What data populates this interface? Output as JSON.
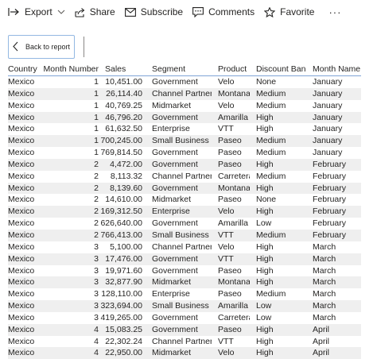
{
  "toolbar": {
    "export_label": "Export",
    "share_label": "Share",
    "subscribe_label": "Subscribe",
    "comments_label": "Comments",
    "favorite_label": "Favorite",
    "more_label": "···"
  },
  "back_button": {
    "label": "Back to report"
  },
  "table": {
    "headers": {
      "country": "Country",
      "month_number": "Month Number",
      "sales": "Sales",
      "segment": "Segment",
      "product": "Product",
      "discount_band": "Discount Band",
      "month_name": "Month Name"
    },
    "rows": [
      [
        "Mexico",
        "1",
        "10,451.00",
        "Government",
        "Velo",
        "None",
        "January"
      ],
      [
        "Mexico",
        "1",
        "26,114.40",
        "Channel Partners",
        "Montana",
        "Medium",
        "January"
      ],
      [
        "Mexico",
        "1",
        "40,769.25",
        "Midmarket",
        "Velo",
        "Medium",
        "January"
      ],
      [
        "Mexico",
        "1",
        "46,796.20",
        "Government",
        "Amarilla",
        "High",
        "January"
      ],
      [
        "Mexico",
        "1",
        "61,632.50",
        "Enterprise",
        "VTT",
        "High",
        "January"
      ],
      [
        "Mexico",
        "1",
        "700,245.00",
        "Small Business",
        "Paseo",
        "Medium",
        "January"
      ],
      [
        "Mexico",
        "1",
        "769,814.50",
        "Government",
        "Paseo",
        "Medium",
        "January"
      ],
      [
        "Mexico",
        "2",
        "4,472.00",
        "Government",
        "Paseo",
        "High",
        "February"
      ],
      [
        "Mexico",
        "2",
        "8,113.32",
        "Channel Partners",
        "Carretera",
        "Medium",
        "February"
      ],
      [
        "Mexico",
        "2",
        "8,139.60",
        "Government",
        "Montana",
        "High",
        "February"
      ],
      [
        "Mexico",
        "2",
        "14,610.00",
        "Midmarket",
        "Paseo",
        "None",
        "February"
      ],
      [
        "Mexico",
        "2",
        "169,312.50",
        "Enterprise",
        "Velo",
        "High",
        "February"
      ],
      [
        "Mexico",
        "2",
        "626,640.00",
        "Government",
        "Amarilla",
        "Low",
        "February"
      ],
      [
        "Mexico",
        "2",
        "766,413.00",
        "Small Business",
        "VTT",
        "Medium",
        "February"
      ],
      [
        "Mexico",
        "3",
        "5,100.00",
        "Channel Partners",
        "Velo",
        "High",
        "March"
      ],
      [
        "Mexico",
        "3",
        "17,476.00",
        "Government",
        "VTT",
        "High",
        "March"
      ],
      [
        "Mexico",
        "3",
        "19,971.60",
        "Government",
        "Paseo",
        "High",
        "March"
      ],
      [
        "Mexico",
        "3",
        "32,877.90",
        "Midmarket",
        "Montana",
        "High",
        "March"
      ],
      [
        "Mexico",
        "3",
        "128,110.00",
        "Enterprise",
        "Paseo",
        "Medium",
        "March"
      ],
      [
        "Mexico",
        "3",
        "323,694.00",
        "Small Business",
        "Amarilla",
        "Low",
        "March"
      ],
      [
        "Mexico",
        "3",
        "419,265.00",
        "Government",
        "Carretera",
        "Low",
        "March"
      ],
      [
        "Mexico",
        "4",
        "15,083.25",
        "Government",
        "Paseo",
        "High",
        "April"
      ],
      [
        "Mexico",
        "4",
        "22,302.24",
        "Channel Partners",
        "VTT",
        "High",
        "April"
      ],
      [
        "Mexico",
        "4",
        "22,950.00",
        "Midmarket",
        "Velo",
        "High",
        "April"
      ]
    ]
  }
}
